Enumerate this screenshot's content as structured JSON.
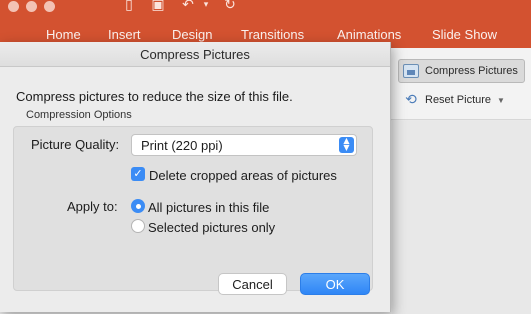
{
  "ribbon": {
    "tabs": [
      "Home",
      "Insert",
      "Design",
      "Transitions",
      "Animations",
      "Slide Show"
    ],
    "buttons": {
      "compress_label": "Compress Pictures",
      "reset_label": "Reset Picture"
    },
    "accent": "#d35230"
  },
  "dialog": {
    "title": "Compress Pictures",
    "description": "Compress pictures to reduce the size of this file.",
    "group_label": "Compression Options",
    "picture_quality_label": "Picture Quality:",
    "picture_quality_value": "Print (220 ppi)",
    "delete_cropped_label": "Delete cropped areas of pictures",
    "delete_cropped_checked": true,
    "apply_to_label": "Apply to:",
    "apply_options": [
      "All pictures in this file",
      "Selected pictures only"
    ],
    "apply_selected_index": 0,
    "cancel_label": "Cancel",
    "ok_label": "OK",
    "accent": "#3b8cf5"
  },
  "icons": {
    "save": "floppy-disk-icon",
    "undo": "undo-icon",
    "redo": "redo-icon",
    "sidebar": "sidebar-icon",
    "select_arrows": "updown-chevron-icon",
    "checkmark": "checkmark-icon"
  }
}
